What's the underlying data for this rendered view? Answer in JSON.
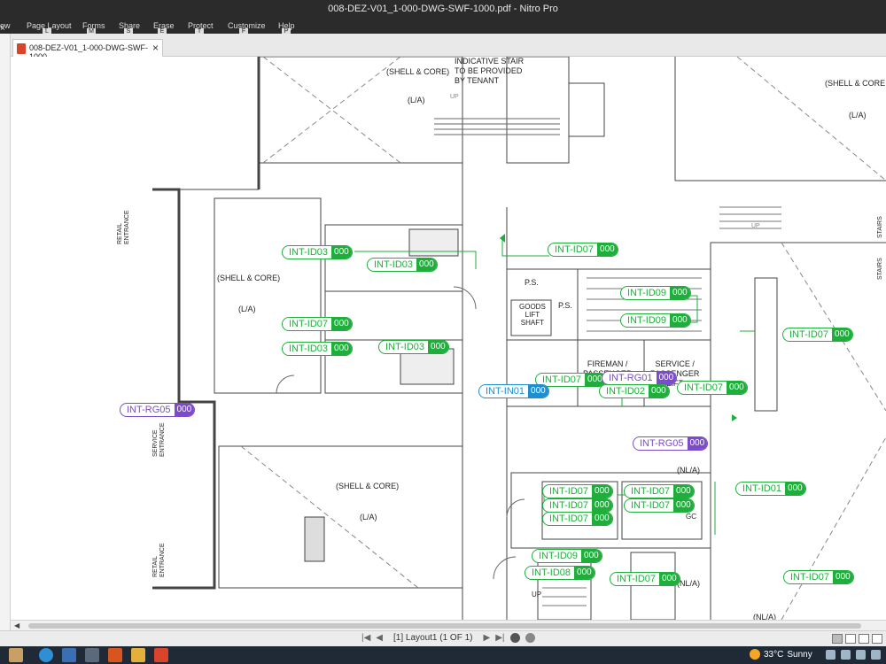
{
  "window": {
    "title": "008-DEZ-V01_1-000-DWG-SWF-1000.pdf - Nitro Pro"
  },
  "ribbon": {
    "tabs": [
      {
        "label": "ew",
        "key": ""
      },
      {
        "label": "Page Layout",
        "key": "L"
      },
      {
        "label": "Forms",
        "key": "M"
      },
      {
        "label": "Share",
        "key": "S"
      },
      {
        "label": "Erase",
        "key": "E"
      },
      {
        "label": "Protect",
        "key": "T"
      },
      {
        "label": "Customize",
        "key": "F"
      },
      {
        "label": "Help",
        "key": "P"
      }
    ],
    "close_glyph": "×"
  },
  "document_tab": {
    "label": "008-DEZ-V01_1-000-DWG-SWF-1000",
    "close_glyph": "×"
  },
  "drawing": {
    "rooms": {
      "shell_core_top": "(SHELL & CORE)",
      "la_top": "(L/A)",
      "shell_core_left": "(SHELL & CORE)",
      "la_left": "(L/A)",
      "shell_core_bottom": "(SHELL & CORE)",
      "la_bottom": "(L/A)",
      "shell_core_right": "(SHELL & CORE",
      "la_right": "(L/A)",
      "nla_mid": "(NL/A)",
      "nla_bottom": "(NL/A)",
      "nla_bottom2": "(NL/A)"
    },
    "notes": {
      "stair_note": "INDICATIVE STAIR\nTO BE PROVIDED\nBY TENANT",
      "ps1": "P.S.",
      "ps2": "P.S.",
      "goods_lift": "GOODS\nLIFT\nSHAFT",
      "fireman": "FIREMAN /\nPASSENGER",
      "service": "SERVICE /\nPASSENGER\nLIFT",
      "up1": "UP",
      "up2": "UP",
      "up3": "UP",
      "gc": "GC"
    },
    "entrances": {
      "retail_top": "RETAIL\nENTRANCE",
      "service": "SERVICE\nENTRANCE",
      "retail_bottom": "RETAIL\nENTRANCE",
      "stairs_1": "STAIRS",
      "stairs_2": "STAIRS"
    },
    "tags": [
      {
        "code": "INT-ID03",
        "num": "000",
        "color": "green"
      },
      {
        "code": "INT-ID03",
        "num": "000",
        "color": "green"
      },
      {
        "code": "INT-ID07",
        "num": "000",
        "color": "green"
      },
      {
        "code": "INT-ID03",
        "num": "000",
        "color": "green"
      },
      {
        "code": "INT-ID03",
        "num": "000",
        "color": "green"
      },
      {
        "code": "INT-RG05",
        "num": "000",
        "color": "purple"
      },
      {
        "code": "INT-ID07",
        "num": "000",
        "color": "green"
      },
      {
        "code": "INT-ID09",
        "num": "000",
        "color": "green"
      },
      {
        "code": "INT-ID09",
        "num": "000",
        "color": "green"
      },
      {
        "code": "INT-ID07",
        "num": "000",
        "color": "green"
      },
      {
        "code": "INT-RG01",
        "num": "000",
        "color": "purple"
      },
      {
        "code": "INT-IN01",
        "num": "000",
        "color": "blue"
      },
      {
        "code": "INT-ID02",
        "num": "000",
        "color": "green"
      },
      {
        "code": "INT-ID07",
        "num": "000",
        "color": "green"
      },
      {
        "code": "INT-ID07",
        "num": "000",
        "color": "green"
      },
      {
        "code": "INT-RG05",
        "num": "000",
        "color": "purple"
      },
      {
        "code": "INT-ID01",
        "num": "000",
        "color": "green"
      },
      {
        "code": "INT-ID07",
        "num": "000",
        "color": "green"
      },
      {
        "code": "INT-ID07",
        "num": "000",
        "color": "green"
      },
      {
        "code": "INT-ID07",
        "num": "000",
        "color": "green"
      },
      {
        "code": "INT-ID07",
        "num": "000",
        "color": "green"
      },
      {
        "code": "INT-ID07",
        "num": "000",
        "color": "green"
      },
      {
        "code": "INT-ID09",
        "num": "000",
        "color": "green"
      },
      {
        "code": "INT-ID08",
        "num": "000",
        "color": "green"
      },
      {
        "code": "INT-ID07",
        "num": "000",
        "color": "green"
      },
      {
        "code": "INT-ID07",
        "num": "000",
        "color": "green"
      }
    ]
  },
  "statusbar": {
    "first": "|◀",
    "prev": "◀",
    "page": "[1] Layout1 (1 OF 1)",
    "next": "▶",
    "last": "▶|"
  },
  "taskbar": {
    "temperature": "33°C",
    "condition": "Sunny"
  },
  "colors": {
    "tag_green": "#1fae3c",
    "tag_purple": "#7c4bc9",
    "tag_blue": "#1d8fd1",
    "titlebar": "#2b2b2b",
    "taskbar": "#1f2a36"
  }
}
